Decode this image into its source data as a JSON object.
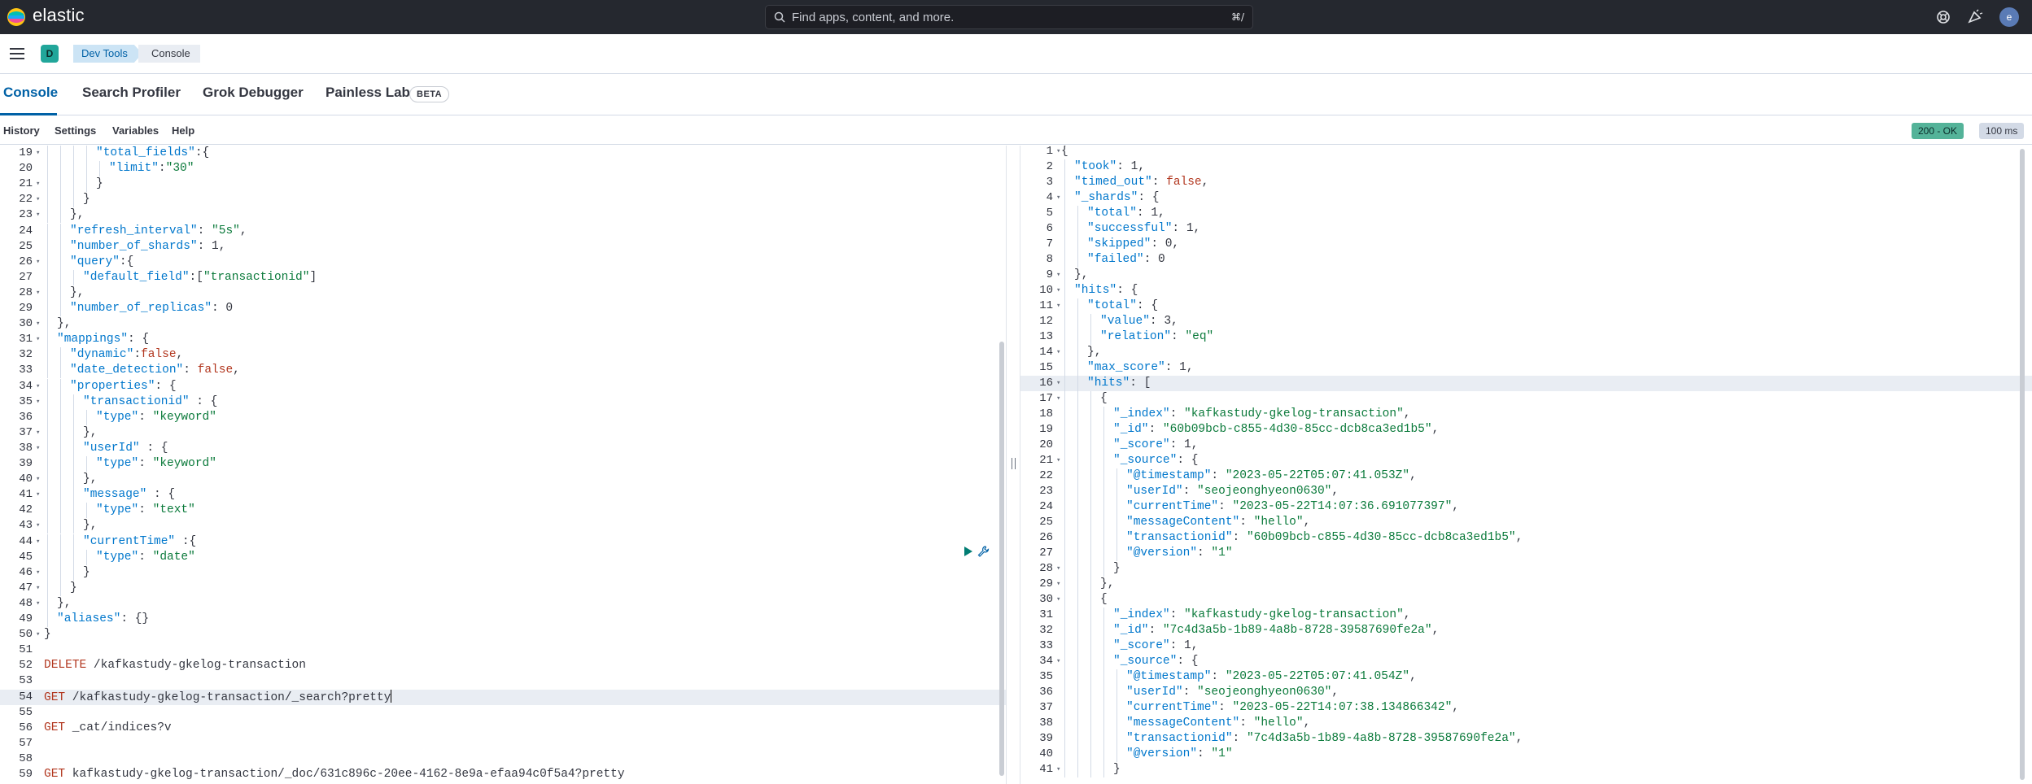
{
  "header": {
    "brand": "elastic",
    "search_placeholder": "Find apps, content, and more.",
    "search_shortcut": "⌘/",
    "avatar_initial": "e"
  },
  "breadcrumbs": {
    "space_initial": "D",
    "items": [
      "Dev Tools",
      "Console"
    ]
  },
  "tabs": [
    {
      "label": "Console",
      "active": true
    },
    {
      "label": "Search Profiler"
    },
    {
      "label": "Grok Debugger"
    },
    {
      "label": "Painless Lab",
      "badge": "BETA"
    }
  ],
  "menu": [
    "History",
    "Settings",
    "Variables",
    "Help"
  ],
  "response_status": {
    "status": "200 - OK",
    "time": "100 ms"
  },
  "request_lines": [
    {
      "n": "19",
      "fold": true,
      "i": 3,
      "t": [
        [
          "k",
          "\"total_fields\""
        ],
        [
          "p",
          ":{"
        ]
      ]
    },
    {
      "n": "20",
      "fold": false,
      "i": 4,
      "t": [
        [
          "k",
          "\"limit\""
        ],
        [
          "p",
          ":"
        ],
        [
          "s",
          "\"30\""
        ]
      ]
    },
    {
      "n": "21",
      "fold": true,
      "i": 3,
      "t": [
        [
          "p",
          "}"
        ]
      ]
    },
    {
      "n": "22",
      "fold": true,
      "i": 2,
      "t": [
        [
          "p",
          "}"
        ]
      ]
    },
    {
      "n": "23",
      "fold": true,
      "i": 1,
      "t": [
        [
          "p",
          "},"
        ]
      ]
    },
    {
      "n": "24",
      "fold": false,
      "i": 1,
      "t": [
        [
          "k",
          "\"refresh_interval\""
        ],
        [
          "p",
          ": "
        ],
        [
          "s",
          "\"5s\""
        ],
        [
          "p",
          ","
        ]
      ]
    },
    {
      "n": "25",
      "fold": false,
      "i": 1,
      "t": [
        [
          "k",
          "\"number_of_shards\""
        ],
        [
          "p",
          ": 1,"
        ]
      ]
    },
    {
      "n": "26",
      "fold": true,
      "i": 1,
      "t": [
        [
          "k",
          "\"query\""
        ],
        [
          "p",
          ":{"
        ]
      ]
    },
    {
      "n": "27",
      "fold": false,
      "i": 2,
      "t": [
        [
          "k",
          "\"default_field\""
        ],
        [
          "p",
          ":["
        ],
        [
          "s",
          "\"transactionid\""
        ],
        [
          "p",
          "]"
        ]
      ]
    },
    {
      "n": "28",
      "fold": true,
      "i": 1,
      "t": [
        [
          "p",
          "},"
        ]
      ]
    },
    {
      "n": "29",
      "fold": false,
      "i": 1,
      "t": [
        [
          "k",
          "\"number_of_replicas\""
        ],
        [
          "p",
          ": 0"
        ]
      ]
    },
    {
      "n": "30",
      "fold": true,
      "i": 0,
      "t": [
        [
          "p",
          "},"
        ]
      ]
    },
    {
      "n": "31",
      "fold": true,
      "i": 0,
      "t": [
        [
          "k",
          "\"mappings\""
        ],
        [
          "p",
          ": {"
        ]
      ]
    },
    {
      "n": "32",
      "fold": false,
      "i": 1,
      "t": [
        [
          "k",
          "\"dynamic\""
        ],
        [
          "p",
          ":"
        ],
        [
          "b",
          "false"
        ],
        [
          "p",
          ","
        ]
      ]
    },
    {
      "n": "33",
      "fold": false,
      "i": 1,
      "t": [
        [
          "k",
          "\"date_detection\""
        ],
        [
          "p",
          ": "
        ],
        [
          "b",
          "false"
        ],
        [
          "p",
          ","
        ]
      ]
    },
    {
      "n": "34",
      "fold": true,
      "i": 1,
      "t": [
        [
          "k",
          "\"properties\""
        ],
        [
          "p",
          ": {"
        ]
      ]
    },
    {
      "n": "35",
      "fold": true,
      "i": 2,
      "t": [
        [
          "k",
          "\"transactionid\""
        ],
        [
          "p",
          " : {"
        ]
      ]
    },
    {
      "n": "36",
      "fold": false,
      "i": 3,
      "t": [
        [
          "k",
          "\"type\""
        ],
        [
          "p",
          ": "
        ],
        [
          "s",
          "\"keyword\""
        ]
      ]
    },
    {
      "n": "37",
      "fold": true,
      "i": 2,
      "t": [
        [
          "p",
          "},"
        ]
      ]
    },
    {
      "n": "38",
      "fold": true,
      "i": 2,
      "t": [
        [
          "k",
          "\"userId\""
        ],
        [
          "p",
          " : {"
        ]
      ]
    },
    {
      "n": "39",
      "fold": false,
      "i": 3,
      "t": [
        [
          "k",
          "\"type\""
        ],
        [
          "p",
          ": "
        ],
        [
          "s",
          "\"keyword\""
        ]
      ]
    },
    {
      "n": "40",
      "fold": true,
      "i": 2,
      "t": [
        [
          "p",
          "},"
        ]
      ]
    },
    {
      "n": "41",
      "fold": true,
      "i": 2,
      "t": [
        [
          "k",
          "\"message\""
        ],
        [
          "p",
          " : {"
        ]
      ]
    },
    {
      "n": "42",
      "fold": false,
      "i": 3,
      "t": [
        [
          "k",
          "\"type\""
        ],
        [
          "p",
          ": "
        ],
        [
          "s",
          "\"text\""
        ]
      ]
    },
    {
      "n": "43",
      "fold": true,
      "i": 2,
      "t": [
        [
          "p",
          "},"
        ]
      ]
    },
    {
      "n": "44",
      "fold": true,
      "i": 2,
      "t": [
        [
          "k",
          "\"currentTime\""
        ],
        [
          "p",
          " :{"
        ]
      ]
    },
    {
      "n": "45",
      "fold": false,
      "i": 3,
      "t": [
        [
          "k",
          "\"type\""
        ],
        [
          "p",
          ": "
        ],
        [
          "s",
          "\"date\""
        ]
      ]
    },
    {
      "n": "46",
      "fold": true,
      "i": 2,
      "t": [
        [
          "p",
          "}"
        ]
      ]
    },
    {
      "n": "47",
      "fold": true,
      "i": 1,
      "t": [
        [
          "p",
          "}"
        ]
      ]
    },
    {
      "n": "48",
      "fold": true,
      "i": 0,
      "t": [
        [
          "p",
          "},"
        ]
      ]
    },
    {
      "n": "49",
      "fold": false,
      "i": 0,
      "t": [
        [
          "k",
          "\"aliases\""
        ],
        [
          "p",
          ": {}"
        ]
      ]
    },
    {
      "n": "50",
      "fold": true,
      "i": -1,
      "t": [
        [
          "p",
          "}"
        ]
      ]
    },
    {
      "n": "51",
      "fold": false,
      "i": -1,
      "t": []
    },
    {
      "n": "52",
      "fold": false,
      "i": -1,
      "t": [
        [
          "m",
          "DELETE"
        ],
        [
          "p",
          " /kafkastudy-gkelog-transaction"
        ]
      ]
    },
    {
      "n": "53",
      "fold": false,
      "i": -1,
      "t": []
    },
    {
      "n": "54",
      "fold": false,
      "i": -1,
      "t": [
        [
          "m",
          "GET"
        ],
        [
          "p",
          " /kafkastudy-gkelog-transaction/_search?pretty"
        ]
      ],
      "active": true
    },
    {
      "n": "55",
      "fold": false,
      "i": -1,
      "t": []
    },
    {
      "n": "56",
      "fold": false,
      "i": -1,
      "t": [
        [
          "m",
          "GET"
        ],
        [
          "p",
          " _cat/indices?v"
        ]
      ]
    },
    {
      "n": "57",
      "fold": false,
      "i": -1,
      "t": []
    },
    {
      "n": "58",
      "fold": false,
      "i": -1,
      "t": []
    },
    {
      "n": "59",
      "fold": false,
      "i": -1,
      "t": [
        [
          "m",
          "GET"
        ],
        [
          "p",
          " kafkastudy-gkelog-transaction/_doc/631c896c-20ee-4162-8e9a-efaa94c0f5a4?pretty"
        ]
      ]
    }
  ],
  "response_lines": [
    {
      "n": "1",
      "fold": true,
      "i": -1,
      "t": [
        [
          "p",
          "{"
        ]
      ]
    },
    {
      "n": "2",
      "fold": false,
      "i": 0,
      "t": [
        [
          "k",
          "\"took\""
        ],
        [
          "p",
          ": 1,"
        ]
      ]
    },
    {
      "n": "3",
      "fold": false,
      "i": 0,
      "t": [
        [
          "k",
          "\"timed_out\""
        ],
        [
          "p",
          ": "
        ],
        [
          "b",
          "false"
        ],
        [
          "p",
          ","
        ]
      ]
    },
    {
      "n": "4",
      "fold": true,
      "i": 0,
      "t": [
        [
          "k",
          "\"_shards\""
        ],
        [
          "p",
          ": {"
        ]
      ]
    },
    {
      "n": "5",
      "fold": false,
      "i": 1,
      "t": [
        [
          "k",
          "\"total\""
        ],
        [
          "p",
          ": 1,"
        ]
      ]
    },
    {
      "n": "6",
      "fold": false,
      "i": 1,
      "t": [
        [
          "k",
          "\"successful\""
        ],
        [
          "p",
          ": 1,"
        ]
      ]
    },
    {
      "n": "7",
      "fold": false,
      "i": 1,
      "t": [
        [
          "k",
          "\"skipped\""
        ],
        [
          "p",
          ": 0,"
        ]
      ]
    },
    {
      "n": "8",
      "fold": false,
      "i": 1,
      "t": [
        [
          "k",
          "\"failed\""
        ],
        [
          "p",
          ": 0"
        ]
      ]
    },
    {
      "n": "9",
      "fold": true,
      "i": 0,
      "t": [
        [
          "p",
          "},"
        ]
      ]
    },
    {
      "n": "10",
      "fold": true,
      "i": 0,
      "t": [
        [
          "k",
          "\"hits\""
        ],
        [
          "p",
          ": {"
        ]
      ]
    },
    {
      "n": "11",
      "fold": true,
      "i": 1,
      "t": [
        [
          "k",
          "\"total\""
        ],
        [
          "p",
          ": {"
        ]
      ]
    },
    {
      "n": "12",
      "fold": false,
      "i": 2,
      "t": [
        [
          "k",
          "\"value\""
        ],
        [
          "p",
          ": 3,"
        ]
      ]
    },
    {
      "n": "13",
      "fold": false,
      "i": 2,
      "t": [
        [
          "k",
          "\"relation\""
        ],
        [
          "p",
          ": "
        ],
        [
          "s",
          "\"eq\""
        ]
      ]
    },
    {
      "n": "14",
      "fold": true,
      "i": 1,
      "t": [
        [
          "p",
          "},"
        ]
      ]
    },
    {
      "n": "15",
      "fold": false,
      "i": 1,
      "t": [
        [
          "k",
          "\"max_score\""
        ],
        [
          "p",
          ": 1,"
        ]
      ]
    },
    {
      "n": "16",
      "fold": true,
      "i": 1,
      "t": [
        [
          "k",
          "\"hits\""
        ],
        [
          "p",
          ": ["
        ]
      ],
      "active": true
    },
    {
      "n": "17",
      "fold": true,
      "i": 2,
      "t": [
        [
          "p",
          "{"
        ]
      ]
    },
    {
      "n": "18",
      "fold": false,
      "i": 3,
      "t": [
        [
          "k",
          "\"_index\""
        ],
        [
          "p",
          ": "
        ],
        [
          "s",
          "\"kafkastudy-gkelog-transaction\""
        ],
        [
          "p",
          ","
        ]
      ]
    },
    {
      "n": "19",
      "fold": false,
      "i": 3,
      "t": [
        [
          "k",
          "\"_id\""
        ],
        [
          "p",
          ": "
        ],
        [
          "s",
          "\"60b09bcb-c855-4d30-85cc-dcb8ca3ed1b5\""
        ],
        [
          "p",
          ","
        ]
      ]
    },
    {
      "n": "20",
      "fold": false,
      "i": 3,
      "t": [
        [
          "k",
          "\"_score\""
        ],
        [
          "p",
          ": 1,"
        ]
      ]
    },
    {
      "n": "21",
      "fold": true,
      "i": 3,
      "t": [
        [
          "k",
          "\"_source\""
        ],
        [
          "p",
          ": {"
        ]
      ]
    },
    {
      "n": "22",
      "fold": false,
      "i": 4,
      "t": [
        [
          "k",
          "\"@timestamp\""
        ],
        [
          "p",
          ": "
        ],
        [
          "s",
          "\"2023-05-22T05:07:41.053Z\""
        ],
        [
          "p",
          ","
        ]
      ]
    },
    {
      "n": "23",
      "fold": false,
      "i": 4,
      "t": [
        [
          "k",
          "\"userId\""
        ],
        [
          "p",
          ": "
        ],
        [
          "s",
          "\"seojeonghyeon0630\""
        ],
        [
          "p",
          ","
        ]
      ]
    },
    {
      "n": "24",
      "fold": false,
      "i": 4,
      "t": [
        [
          "k",
          "\"currentTime\""
        ],
        [
          "p",
          ": "
        ],
        [
          "s",
          "\"2023-05-22T14:07:36.691077397\""
        ],
        [
          "p",
          ","
        ]
      ]
    },
    {
      "n": "25",
      "fold": false,
      "i": 4,
      "t": [
        [
          "k",
          "\"messageContent\""
        ],
        [
          "p",
          ": "
        ],
        [
          "s",
          "\"hello\""
        ],
        [
          "p",
          ","
        ]
      ]
    },
    {
      "n": "26",
      "fold": false,
      "i": 4,
      "t": [
        [
          "k",
          "\"transactionid\""
        ],
        [
          "p",
          ": "
        ],
        [
          "s",
          "\"60b09bcb-c855-4d30-85cc-dcb8ca3ed1b5\""
        ],
        [
          "p",
          ","
        ]
      ]
    },
    {
      "n": "27",
      "fold": false,
      "i": 4,
      "t": [
        [
          "k",
          "\"@version\""
        ],
        [
          "p",
          ": "
        ],
        [
          "s",
          "\"1\""
        ]
      ]
    },
    {
      "n": "28",
      "fold": true,
      "i": 3,
      "t": [
        [
          "p",
          "}"
        ]
      ]
    },
    {
      "n": "29",
      "fold": true,
      "i": 2,
      "t": [
        [
          "p",
          "},"
        ]
      ]
    },
    {
      "n": "30",
      "fold": true,
      "i": 2,
      "t": [
        [
          "p",
          "{"
        ]
      ]
    },
    {
      "n": "31",
      "fold": false,
      "i": 3,
      "t": [
        [
          "k",
          "\"_index\""
        ],
        [
          "p",
          ": "
        ],
        [
          "s",
          "\"kafkastudy-gkelog-transaction\""
        ],
        [
          "p",
          ","
        ]
      ]
    },
    {
      "n": "32",
      "fold": false,
      "i": 3,
      "t": [
        [
          "k",
          "\"_id\""
        ],
        [
          "p",
          ": "
        ],
        [
          "s",
          "\"7c4d3a5b-1b89-4a8b-8728-39587690fe2a\""
        ],
        [
          "p",
          ","
        ]
      ]
    },
    {
      "n": "33",
      "fold": false,
      "i": 3,
      "t": [
        [
          "k",
          "\"_score\""
        ],
        [
          "p",
          ": 1,"
        ]
      ]
    },
    {
      "n": "34",
      "fold": true,
      "i": 3,
      "t": [
        [
          "k",
          "\"_source\""
        ],
        [
          "p",
          ": {"
        ]
      ]
    },
    {
      "n": "35",
      "fold": false,
      "i": 4,
      "t": [
        [
          "k",
          "\"@timestamp\""
        ],
        [
          "p",
          ": "
        ],
        [
          "s",
          "\"2023-05-22T05:07:41.054Z\""
        ],
        [
          "p",
          ","
        ]
      ]
    },
    {
      "n": "36",
      "fold": false,
      "i": 4,
      "t": [
        [
          "k",
          "\"userId\""
        ],
        [
          "p",
          ": "
        ],
        [
          "s",
          "\"seojeonghyeon0630\""
        ],
        [
          "p",
          ","
        ]
      ]
    },
    {
      "n": "37",
      "fold": false,
      "i": 4,
      "t": [
        [
          "k",
          "\"currentTime\""
        ],
        [
          "p",
          ": "
        ],
        [
          "s",
          "\"2023-05-22T14:07:38.134866342\""
        ],
        [
          "p",
          ","
        ]
      ]
    },
    {
      "n": "38",
      "fold": false,
      "i": 4,
      "t": [
        [
          "k",
          "\"messageContent\""
        ],
        [
          "p",
          ": "
        ],
        [
          "s",
          "\"hello\""
        ],
        [
          "p",
          ","
        ]
      ]
    },
    {
      "n": "39",
      "fold": false,
      "i": 4,
      "t": [
        [
          "k",
          "\"transactionid\""
        ],
        [
          "p",
          ": "
        ],
        [
          "s",
          "\"7c4d3a5b-1b89-4a8b-8728-39587690fe2a\""
        ],
        [
          "p",
          ","
        ]
      ]
    },
    {
      "n": "40",
      "fold": false,
      "i": 4,
      "t": [
        [
          "k",
          "\"@version\""
        ],
        [
          "p",
          ": "
        ],
        [
          "s",
          "\"1\""
        ]
      ]
    },
    {
      "n": "41",
      "fold": true,
      "i": 3,
      "t": [
        [
          "p",
          "}"
        ]
      ]
    }
  ]
}
